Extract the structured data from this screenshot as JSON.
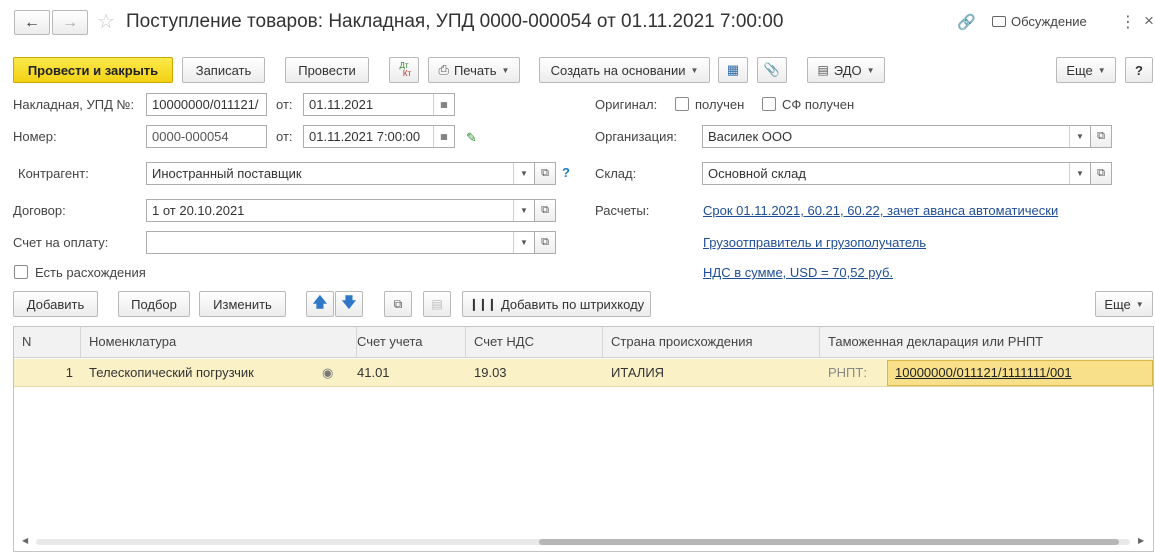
{
  "window": {
    "title": "Поступление товаров: Накладная, УПД 0000-000054 от 01.11.2021 7:00:00",
    "discussion_label": "Обсуждение"
  },
  "toolbar": {
    "post_close": "Провести и закрыть",
    "save": "Записать",
    "post": "Провести",
    "dtkt_top": "Дт",
    "dtkt_bottom": "Кт",
    "print": "Печать",
    "create_based": "Создать на основании",
    "edo": "ЭДО",
    "more": "Еще",
    "help": "?"
  },
  "form": {
    "invoice_label": "Накладная, УПД №:",
    "invoice_value": "10000000/011121/",
    "from_label": "от:",
    "invoice_date": "01.11.2021",
    "number_label": "Номер:",
    "number_value": "0000-000054",
    "number_date": "01.11.2021  7:00:00",
    "counterparty_label": "Контрагент:",
    "counterparty_value": "Иностранный поставщик",
    "question_mark": "?",
    "contract_label": "Договор:",
    "contract_value": "1 от 20.10.2021",
    "invoice_pay_label": "Счет на оплату:",
    "invoice_pay_value": "",
    "discrepancy_label": "Есть расхождения",
    "original_label": "Оригинал:",
    "received_label": "получен",
    "sf_received_label": "СФ получен",
    "org_label": "Организация:",
    "org_value": "Василек ООО",
    "warehouse_label": "Склад:",
    "warehouse_value": "Основной склад",
    "settlements_label": "Расчеты:",
    "settlements_link": "Срок 01.11.2021, 60.21, 60.22, зачет аванса автоматически",
    "shipper_link": "Грузоотправитель и грузополучатель",
    "vat_link": "НДС в сумме, USD = 70,52 руб."
  },
  "table_toolbar": {
    "add": "Добавить",
    "pick": "Подбор",
    "change": "Изменить",
    "add_barcode": "Добавить по штрихкоду",
    "more": "Еще"
  },
  "table": {
    "headers": [
      "N",
      "Номенклатура",
      "Счет учета",
      "Счет НДС",
      "Страна происхождения",
      "Таможенная декларация или РНПТ"
    ],
    "rows": [
      {
        "n": "1",
        "item": "Телескопический погрузчик",
        "account": "41.01",
        "vat_account": "19.03",
        "country": "ИТАЛИЯ",
        "rnpt_label": "РНПТ:",
        "rnpt_value": "10000000/011121/1111111/001"
      }
    ]
  },
  "colors": {
    "primary_button": "#f3d214",
    "selected_row": "#fbf1c7",
    "selected_cell": "#f7e089",
    "link": "#1f4e96"
  }
}
